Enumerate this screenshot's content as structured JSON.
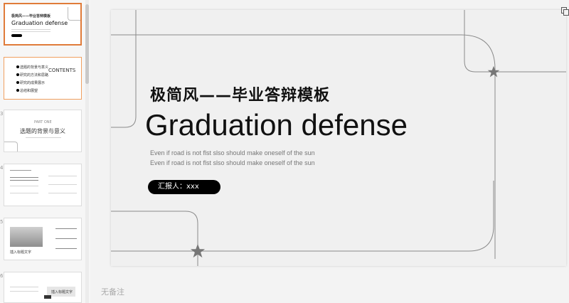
{
  "thumbnails": [
    {
      "number": "",
      "title_cn": "极简风——毕业答辩模板",
      "title_en": "Graduation defense"
    },
    {
      "number": "",
      "heading": "CONTENTS",
      "items": [
        "选题的背景与意义",
        "研究的方法和思路",
        "研究的成果展示",
        "总结和展望"
      ]
    },
    {
      "number": "3",
      "part": "PART ONE",
      "heading": "选题的背景与意义"
    },
    {
      "number": "4"
    },
    {
      "number": "5",
      "caption": "插入标题文字"
    },
    {
      "number": "6",
      "caption": "插入标题文字"
    }
  ],
  "slide": {
    "title_cn": "极简风——毕业答辩模板",
    "title_en": "Graduation defense",
    "subtitle_1": "Even if road is not flst slso should make oneself of the sun",
    "subtitle_2": "Even if road is not flst slso should make oneself of the sun",
    "presenter": "汇报人：xxx"
  },
  "notes_placeholder": "无备注",
  "icons": {
    "corner": "copy-icon",
    "star": "star-icon"
  },
  "colors": {
    "active_border": "#e07b39",
    "accent": "#000000"
  }
}
